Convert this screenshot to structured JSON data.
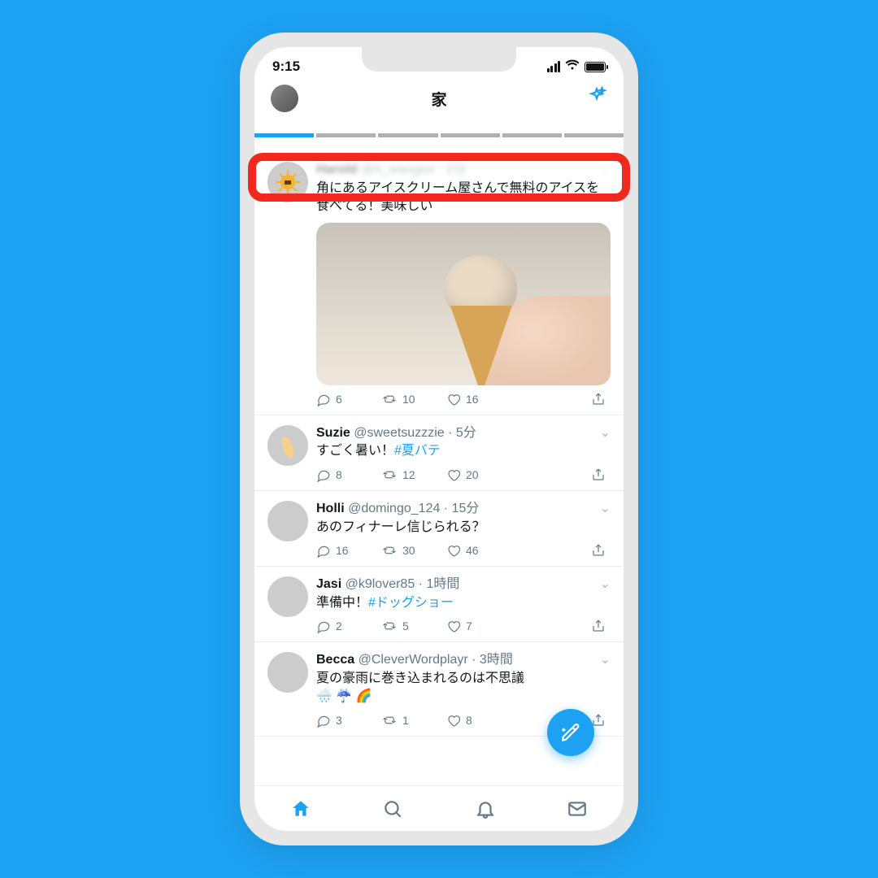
{
  "status": {
    "time": "9:15"
  },
  "header": {
    "title": "家"
  },
  "fleets": {
    "segments": 6,
    "active_index": 0
  },
  "tweets": [
    {
      "name": "",
      "handle": "",
      "time": "",
      "text": "角にあるアイスクリーム屋さんで無料のアイスを食べてる！美味しい",
      "has_media": true,
      "replies": "6",
      "retweets": "10",
      "likes": "16",
      "avatar_class": "sun"
    },
    {
      "name": "Suzie",
      "handle": "@sweetsuzzzie",
      "time": "5分",
      "text_prefix": "すごく暑い！",
      "hashtag": "#夏バテ",
      "replies": "8",
      "retweets": "12",
      "likes": "20",
      "avatar_class": "surf"
    },
    {
      "name": "Holli",
      "handle": "@domingo_124",
      "time": "15分",
      "text": "あのフィナーレ信じられる？",
      "replies": "16",
      "retweets": "30",
      "likes": "46",
      "avatar_class": "dog"
    },
    {
      "name": "Jasi",
      "handle": "@k9lover85",
      "time": "1時間",
      "text_prefix": "準備中！",
      "hashtag": "#ドッグショー",
      "replies": "2",
      "retweets": "5",
      "likes": "7",
      "avatar_class": "pug"
    },
    {
      "name": "Becca",
      "handle": "@CleverWordplayr",
      "time": "3時間",
      "text": "夏の豪雨に巻き込まれるのは不思議",
      "emoji": "🌧️ ☔ 🌈",
      "replies": "3",
      "retweets": "1",
      "likes": "8",
      "avatar_class": "coffee"
    }
  ]
}
